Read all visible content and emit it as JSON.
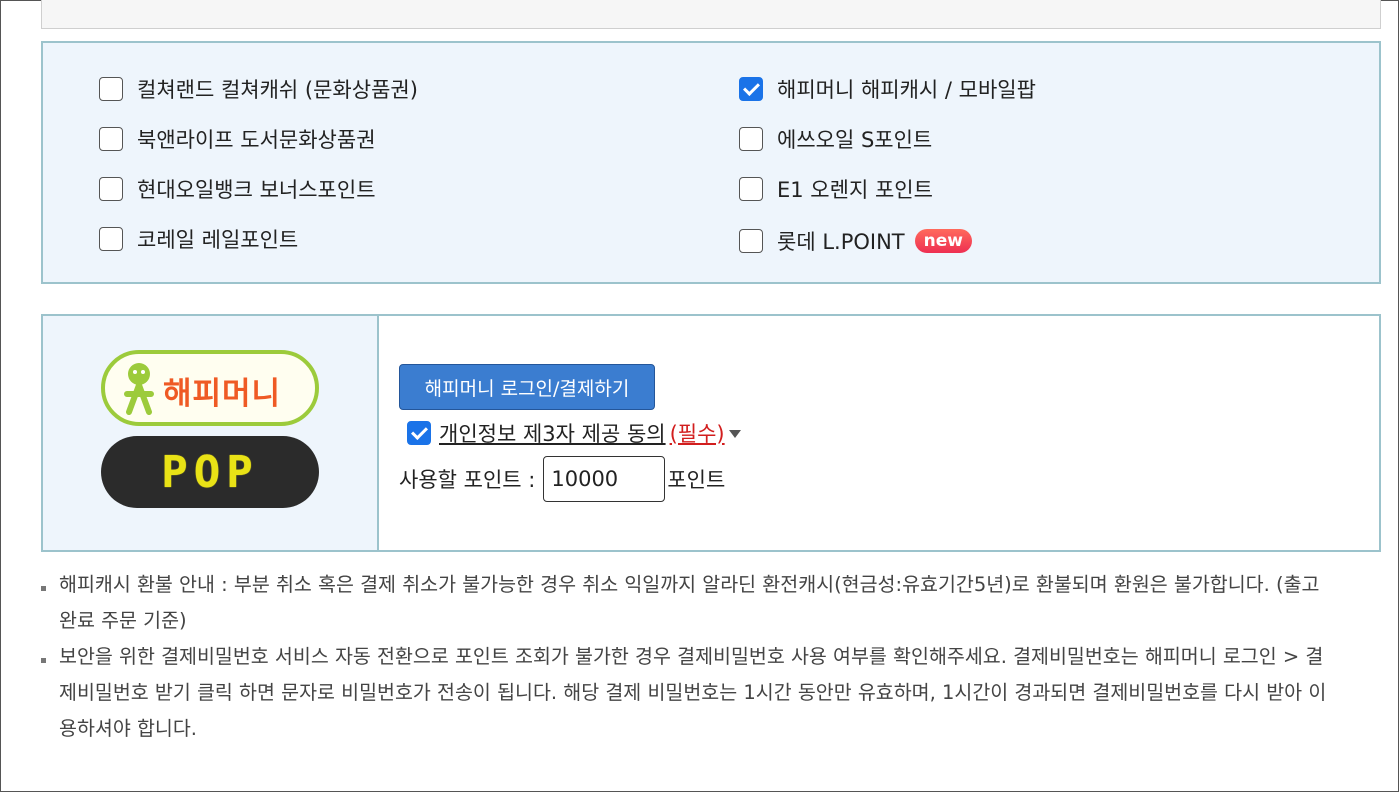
{
  "options": [
    {
      "label": "컬쳐랜드 컬쳐캐쉬 (문화상품권)",
      "checked": false
    },
    {
      "label": "해피머니 해피캐시 / 모바일팝",
      "checked": true
    },
    {
      "label": "북앤라이프 도서문화상품권",
      "checked": false
    },
    {
      "label": "에쓰오일 S포인트",
      "checked": false
    },
    {
      "label": "현대오일뱅크 보너스포인트",
      "checked": false
    },
    {
      "label": "E1 오렌지 포인트",
      "checked": false
    },
    {
      "label": "코레일 레일포인트",
      "checked": false
    },
    {
      "label": "롯데 L.POINT",
      "checked": false,
      "badge": "new"
    }
  ],
  "logos": {
    "happymoney": "해피머니",
    "pop": "POP"
  },
  "payment": {
    "login_button": "해피머니 로그인/결제하기",
    "consent_text": "개인정보 제3자 제공 동의",
    "consent_required": "(필수)",
    "points_label": "사용할 포인트 :",
    "points_value": "10000",
    "points_unit": "포인트"
  },
  "notices": [
    "해피캐시 환불 안내 : 부분 취소 혹은 결제 취소가 불가능한 경우 취소 익일까지 알라딘 환전캐시(현금성:유효기간5년)로 환불되며 환원은 불가합니다. (출고 완료 주문 기준)",
    "보안을 위한 결제비밀번호 서비스 자동 전환으로 포인트 조회가 불가한 경우 결제비밀번호 사용 여부를 확인해주세요. 결제비밀번호는 해피머니 로그인 > 결제비밀번호 받기 클릭 하면 문자로 비밀번호가 전송이 됩니다. 해당 결제 비밀번호는 1시간 동안만 유효하며, 1시간이 경과되면 결제비밀번호를 다시 받아 이용하셔야 합니다."
  ],
  "colors": {
    "panel_bg": "#eef5fc",
    "panel_border": "#9cc3cc",
    "button_blue": "#3b7dd0",
    "required_red": "#d21e1e",
    "check_blue": "#1a73e8"
  }
}
